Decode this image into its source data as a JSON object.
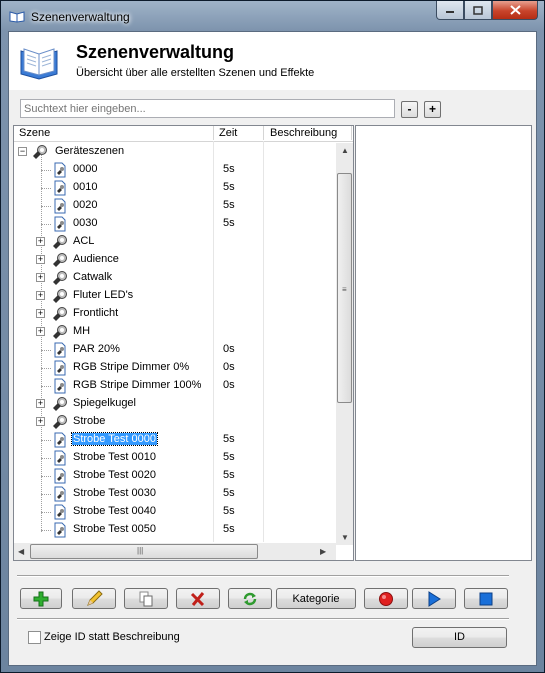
{
  "window": {
    "title": "Szenenverwaltung"
  },
  "header": {
    "title": "Szenenverwaltung",
    "subtitle": "Übersicht über alle erstellten Szenen und Effekte"
  },
  "search": {
    "placeholder": "Suchtext hier eingeben...",
    "minus_label": "-",
    "plus_label": "+"
  },
  "tree": {
    "columns": {
      "scene": "Szene",
      "time": "Zeit",
      "description": "Beschreibung"
    },
    "rows": [
      {
        "label": "Geräteszenen",
        "time": "",
        "type": "folder",
        "expander": "minus",
        "level": 0
      },
      {
        "label": "0000",
        "time": "5s",
        "type": "scene",
        "level": 1
      },
      {
        "label": "0010",
        "time": "5s",
        "type": "scene",
        "level": 1
      },
      {
        "label": "0020",
        "time": "5s",
        "type": "scene",
        "level": 1
      },
      {
        "label": "0030",
        "time": "5s",
        "type": "scene",
        "level": 1
      },
      {
        "label": "ACL",
        "time": "",
        "type": "folder",
        "expander": "plus",
        "level": 1
      },
      {
        "label": "Audience",
        "time": "",
        "type": "folder",
        "expander": "plus",
        "level": 1
      },
      {
        "label": "Catwalk",
        "time": "",
        "type": "folder",
        "expander": "plus",
        "level": 1
      },
      {
        "label": "Fluter LED's",
        "time": "",
        "type": "folder",
        "expander": "plus",
        "level": 1
      },
      {
        "label": "Frontlicht",
        "time": "",
        "type": "folder",
        "expander": "plus",
        "level": 1
      },
      {
        "label": "MH",
        "time": "",
        "type": "folder",
        "expander": "plus",
        "level": 1
      },
      {
        "label": "PAR 20%",
        "time": "0s",
        "type": "scene",
        "level": 1
      },
      {
        "label": "RGB Stripe Dimmer 0%",
        "time": "0s",
        "type": "scene",
        "level": 1
      },
      {
        "label": "RGB Stripe Dimmer 100%",
        "time": "0s",
        "type": "scene",
        "level": 1
      },
      {
        "label": "Spiegelkugel",
        "time": "",
        "type": "folder",
        "expander": "plus",
        "level": 1
      },
      {
        "label": "Strobe",
        "time": "",
        "type": "folder",
        "expander": "plus",
        "level": 1
      },
      {
        "label": "Strobe Test 0000",
        "time": "5s",
        "type": "scene",
        "level": 1,
        "selected": true
      },
      {
        "label": "Strobe Test 0010",
        "time": "5s",
        "type": "scene",
        "level": 1
      },
      {
        "label": "Strobe Test 0020",
        "time": "5s",
        "type": "scene",
        "level": 1
      },
      {
        "label": "Strobe Test 0030",
        "time": "5s",
        "type": "scene",
        "level": 1
      },
      {
        "label": "Strobe Test 0040",
        "time": "5s",
        "type": "scene",
        "level": 1
      },
      {
        "label": "Strobe Test 0050",
        "time": "5s",
        "type": "scene",
        "level": 1
      }
    ]
  },
  "toolbar": {
    "buttons": [
      {
        "name": "add-button",
        "icon": "plus-icon"
      },
      {
        "name": "edit-button",
        "icon": "pencil-icon"
      },
      {
        "name": "copy-button",
        "icon": "copy-icon"
      },
      {
        "name": "delete-button",
        "icon": "x-icon"
      },
      {
        "name": "refresh-button",
        "icon": "refresh-icon"
      },
      {
        "name": "category-button",
        "label": "Kategorie"
      },
      {
        "name": "record-button",
        "icon": "record-icon"
      },
      {
        "name": "play-button",
        "icon": "play-icon"
      },
      {
        "name": "stop-button",
        "icon": "stop-icon"
      }
    ]
  },
  "footer": {
    "show_id_label": "Zeige ID statt Beschreibung",
    "show_id_checked": false,
    "id_button_label": "ID"
  },
  "colors": {
    "accent_green": "#2fae2f",
    "delete_red": "#c0201a",
    "record_red": "#e02020",
    "play_blue": "#1a6fd8",
    "selection": "#3399ff"
  }
}
